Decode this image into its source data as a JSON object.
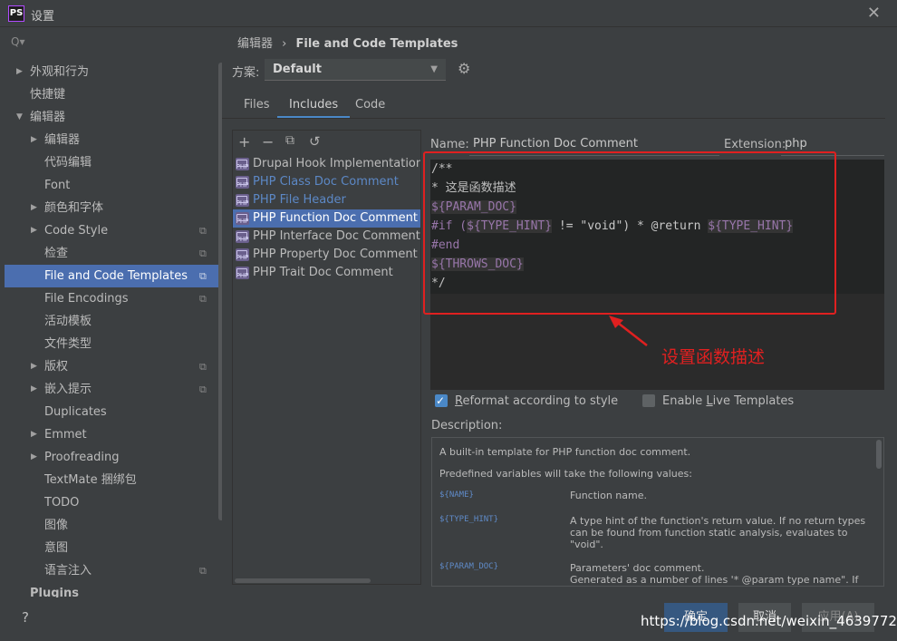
{
  "window": {
    "title": "设置",
    "app_icon": "PS"
  },
  "sidebar": {
    "search_placeholder": "Q▾",
    "items": [
      {
        "label": "外观和行为",
        "arrow": "▶"
      },
      {
        "label": "快捷键",
        "arrow": ""
      },
      {
        "label": "编辑器",
        "arrow": "▼"
      },
      {
        "label": "编辑器",
        "arrow": "▶"
      },
      {
        "label": "代码编辑",
        "arrow": ""
      },
      {
        "label": "Font",
        "arrow": ""
      },
      {
        "label": "颜色和字体",
        "arrow": "▶"
      },
      {
        "label": "Code Style",
        "arrow": "▶"
      },
      {
        "label": "检查",
        "arrow": ""
      },
      {
        "label": "File and Code Templates",
        "arrow": ""
      },
      {
        "label": "File Encodings",
        "arrow": ""
      },
      {
        "label": "活动模板",
        "arrow": ""
      },
      {
        "label": "文件类型",
        "arrow": ""
      },
      {
        "label": "版权",
        "arrow": "▶"
      },
      {
        "label": "嵌入提示",
        "arrow": "▶"
      },
      {
        "label": "Duplicates",
        "arrow": ""
      },
      {
        "label": "Emmet",
        "arrow": "▶"
      },
      {
        "label": "Proofreading",
        "arrow": "▶"
      },
      {
        "label": "TextMate 捆绑包",
        "arrow": ""
      },
      {
        "label": "TODO",
        "arrow": ""
      },
      {
        "label": "图像",
        "arrow": ""
      },
      {
        "label": "意图",
        "arrow": ""
      },
      {
        "label": "语言注入",
        "arrow": ""
      },
      {
        "label": "Plugins",
        "arrow": ""
      }
    ]
  },
  "breadcrumb": {
    "parent": "编辑器",
    "separator": "›",
    "current": "File and Code Templates"
  },
  "scheme": {
    "label": "方案:",
    "value": "Default"
  },
  "tabs": [
    {
      "label": "Files"
    },
    {
      "label": "Includes"
    },
    {
      "label": "Code"
    }
  ],
  "templates": [
    {
      "label": "Drupal Hook Implementation Doc"
    },
    {
      "label": "PHP Class Doc Comment"
    },
    {
      "label": "PHP File Header"
    },
    {
      "label": "PHP Function Doc Comment"
    },
    {
      "label": "PHP Interface Doc Comment"
    },
    {
      "label": "PHP Property Doc Comment"
    },
    {
      "label": "PHP Trait Doc Comment"
    }
  ],
  "form": {
    "name_label": "Name:",
    "name_value": "PHP Function Doc Comment",
    "ext_label": "Extension:",
    "ext_value": "php"
  },
  "editor": {
    "l1": "/**",
    "l2": "* 这是函数描述",
    "v_param": "${PARAM_DOC}",
    "if_kw": "#if (",
    "v_hint": "${TYPE_HINT}",
    "if_mid": " != \"void\") * @return ",
    "if_end": ")",
    "end_kw": "#end",
    "v_throws": "${THROWS_DOC}",
    "l_close": "*/"
  },
  "annotation": "设置函数描述",
  "checkboxes": {
    "reformat": {
      "pre": "",
      "u": "R",
      "post": "eformat according to style",
      "checked": true
    },
    "live": {
      "pre": "Enable ",
      "u": "L",
      "post": "ive Templates",
      "checked": false
    }
  },
  "description": {
    "label": "Description:",
    "p1": "A built-in template for PHP function doc comment.",
    "p2": "Predefined variables will take the following values:",
    "vars": [
      {
        "name": "${NAME}",
        "text": "Function name."
      },
      {
        "name": "${TYPE_HINT}",
        "text": "A type hint of the function's return value. If no return types can be found from function static analysis, evaluates to \"void\"."
      },
      {
        "name": "${PARAM_DOC}",
        "text": "Parameters' doc comment.\nGenerated as a number of lines '* @param type name\". If"
      }
    ]
  },
  "buttons": {
    "help": "?",
    "ok": "确定",
    "cancel": "取消",
    "apply": "应用(A)"
  },
  "watermark": "https://blog.csdn.net/weixin_46397725"
}
